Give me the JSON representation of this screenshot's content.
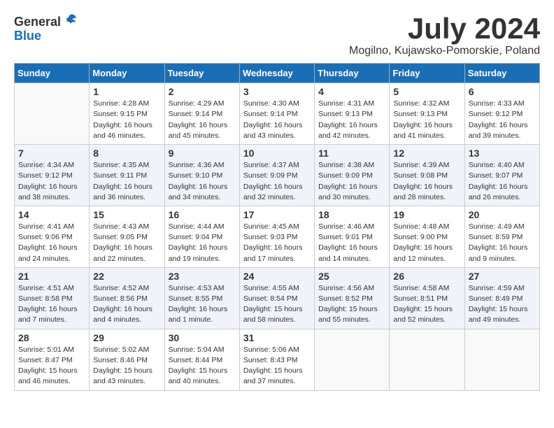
{
  "logo": {
    "general": "General",
    "blue": "Blue"
  },
  "title": "July 2024",
  "location": "Mogilno, Kujawsko-Pomorskie, Poland",
  "days_of_week": [
    "Sunday",
    "Monday",
    "Tuesday",
    "Wednesday",
    "Thursday",
    "Friday",
    "Saturday"
  ],
  "weeks": [
    [
      {
        "day": "",
        "info": ""
      },
      {
        "day": "1",
        "info": "Sunrise: 4:28 AM\nSunset: 9:15 PM\nDaylight: 16 hours\nand 46 minutes."
      },
      {
        "day": "2",
        "info": "Sunrise: 4:29 AM\nSunset: 9:14 PM\nDaylight: 16 hours\nand 45 minutes."
      },
      {
        "day": "3",
        "info": "Sunrise: 4:30 AM\nSunset: 9:14 PM\nDaylight: 16 hours\nand 43 minutes."
      },
      {
        "day": "4",
        "info": "Sunrise: 4:31 AM\nSunset: 9:13 PM\nDaylight: 16 hours\nand 42 minutes."
      },
      {
        "day": "5",
        "info": "Sunrise: 4:32 AM\nSunset: 9:13 PM\nDaylight: 16 hours\nand 41 minutes."
      },
      {
        "day": "6",
        "info": "Sunrise: 4:33 AM\nSunset: 9:12 PM\nDaylight: 16 hours\nand 39 minutes."
      }
    ],
    [
      {
        "day": "7",
        "info": "Sunrise: 4:34 AM\nSunset: 9:12 PM\nDaylight: 16 hours\nand 38 minutes."
      },
      {
        "day": "8",
        "info": "Sunrise: 4:35 AM\nSunset: 9:11 PM\nDaylight: 16 hours\nand 36 minutes."
      },
      {
        "day": "9",
        "info": "Sunrise: 4:36 AM\nSunset: 9:10 PM\nDaylight: 16 hours\nand 34 minutes."
      },
      {
        "day": "10",
        "info": "Sunrise: 4:37 AM\nSunset: 9:09 PM\nDaylight: 16 hours\nand 32 minutes."
      },
      {
        "day": "11",
        "info": "Sunrise: 4:38 AM\nSunset: 9:09 PM\nDaylight: 16 hours\nand 30 minutes."
      },
      {
        "day": "12",
        "info": "Sunrise: 4:39 AM\nSunset: 9:08 PM\nDaylight: 16 hours\nand 28 minutes."
      },
      {
        "day": "13",
        "info": "Sunrise: 4:40 AM\nSunset: 9:07 PM\nDaylight: 16 hours\nand 26 minutes."
      }
    ],
    [
      {
        "day": "14",
        "info": "Sunrise: 4:41 AM\nSunset: 9:06 PM\nDaylight: 16 hours\nand 24 minutes."
      },
      {
        "day": "15",
        "info": "Sunrise: 4:43 AM\nSunset: 9:05 PM\nDaylight: 16 hours\nand 22 minutes."
      },
      {
        "day": "16",
        "info": "Sunrise: 4:44 AM\nSunset: 9:04 PM\nDaylight: 16 hours\nand 19 minutes."
      },
      {
        "day": "17",
        "info": "Sunrise: 4:45 AM\nSunset: 9:03 PM\nDaylight: 16 hours\nand 17 minutes."
      },
      {
        "day": "18",
        "info": "Sunrise: 4:46 AM\nSunset: 9:01 PM\nDaylight: 16 hours\nand 14 minutes."
      },
      {
        "day": "19",
        "info": "Sunrise: 4:48 AM\nSunset: 9:00 PM\nDaylight: 16 hours\nand 12 minutes."
      },
      {
        "day": "20",
        "info": "Sunrise: 4:49 AM\nSunset: 8:59 PM\nDaylight: 16 hours\nand 9 minutes."
      }
    ],
    [
      {
        "day": "21",
        "info": "Sunrise: 4:51 AM\nSunset: 8:58 PM\nDaylight: 16 hours\nand 7 minutes."
      },
      {
        "day": "22",
        "info": "Sunrise: 4:52 AM\nSunset: 8:56 PM\nDaylight: 16 hours\nand 4 minutes."
      },
      {
        "day": "23",
        "info": "Sunrise: 4:53 AM\nSunset: 8:55 PM\nDaylight: 16 hours\nand 1 minute."
      },
      {
        "day": "24",
        "info": "Sunrise: 4:55 AM\nSunset: 8:54 PM\nDaylight: 15 hours\nand 58 minutes."
      },
      {
        "day": "25",
        "info": "Sunrise: 4:56 AM\nSunset: 8:52 PM\nDaylight: 15 hours\nand 55 minutes."
      },
      {
        "day": "26",
        "info": "Sunrise: 4:58 AM\nSunset: 8:51 PM\nDaylight: 15 hours\nand 52 minutes."
      },
      {
        "day": "27",
        "info": "Sunrise: 4:59 AM\nSunset: 8:49 PM\nDaylight: 15 hours\nand 49 minutes."
      }
    ],
    [
      {
        "day": "28",
        "info": "Sunrise: 5:01 AM\nSunset: 8:47 PM\nDaylight: 15 hours\nand 46 minutes."
      },
      {
        "day": "29",
        "info": "Sunrise: 5:02 AM\nSunset: 8:46 PM\nDaylight: 15 hours\nand 43 minutes."
      },
      {
        "day": "30",
        "info": "Sunrise: 5:04 AM\nSunset: 8:44 PM\nDaylight: 15 hours\nand 40 minutes."
      },
      {
        "day": "31",
        "info": "Sunrise: 5:06 AM\nSunset: 8:43 PM\nDaylight: 15 hours\nand 37 minutes."
      },
      {
        "day": "",
        "info": ""
      },
      {
        "day": "",
        "info": ""
      },
      {
        "day": "",
        "info": ""
      }
    ]
  ]
}
